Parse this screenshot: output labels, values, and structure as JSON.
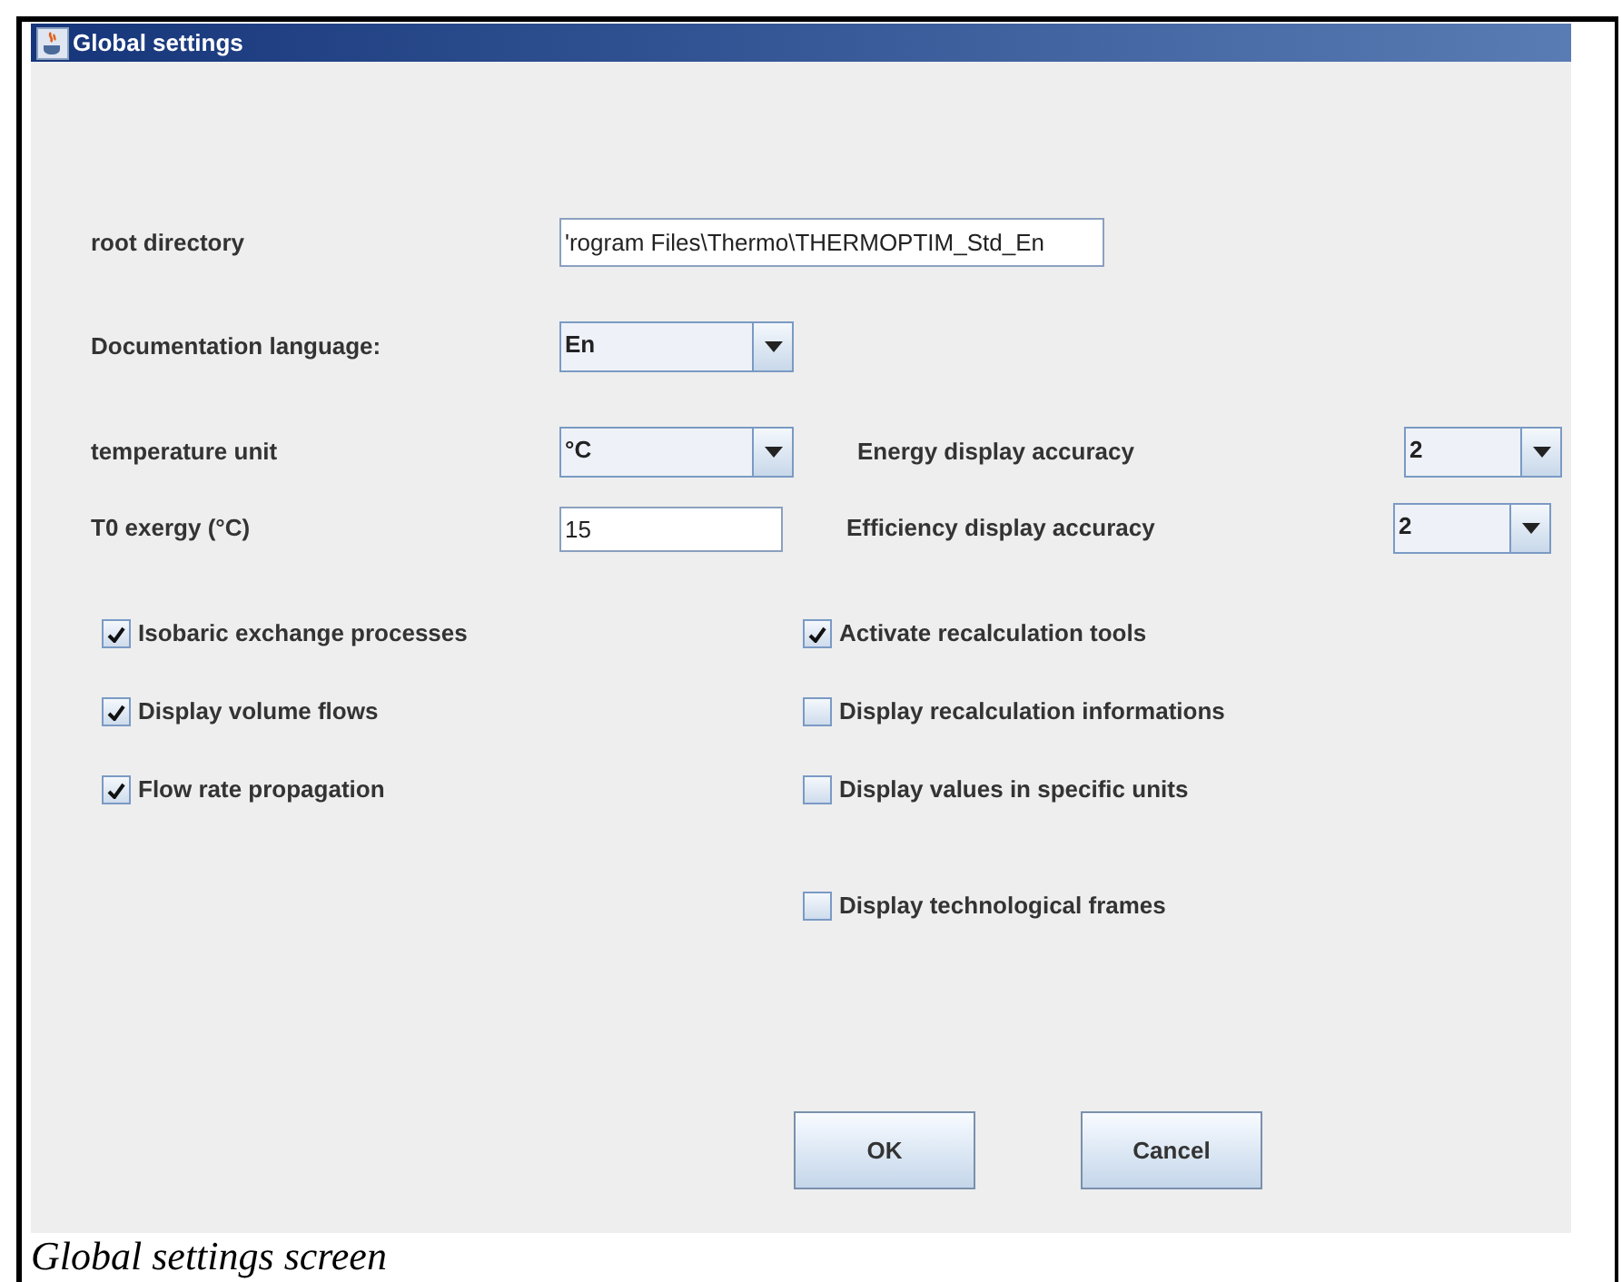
{
  "window": {
    "title": "Global settings"
  },
  "rows": [
    [
      {
        "label": "root directory",
        "kind": "text",
        "value": "'rogram Files\\Thermo\\THERMOPTIM_Std_En"
      }
    ],
    [
      {
        "label": "Documentation language:",
        "kind": "dropdown",
        "value": "En"
      }
    ],
    [
      {
        "label": "temperature unit",
        "kind": "dropdown",
        "value": "°C"
      },
      {
        "label": "Energy display accuracy",
        "kind": "dropdown",
        "value": "2"
      }
    ],
    [
      {
        "label": "T0 exergy (°C)",
        "kind": "text",
        "value": "15"
      },
      {
        "label": "Efficiency display accuracy",
        "kind": "dropdown",
        "value": "2"
      }
    ]
  ],
  "left_options": [
    {
      "label": "Isobaric exchange processes",
      "checked": true
    },
    {
      "label": "Display volume flows",
      "checked": true
    },
    {
      "label": "Flow rate propagation",
      "checked": true
    }
  ],
  "right_options": [
    {
      "label": "Activate recalculation tools",
      "checked": true
    },
    {
      "label": "Display recalculation informations",
      "checked": false
    },
    {
      "label": "Display values in specific units",
      "checked": false
    },
    {
      "label": "Display technological frames",
      "checked": false
    }
  ],
  "buttons": [
    "OK",
    "Cancel"
  ],
  "caption": "Global settings screen"
}
